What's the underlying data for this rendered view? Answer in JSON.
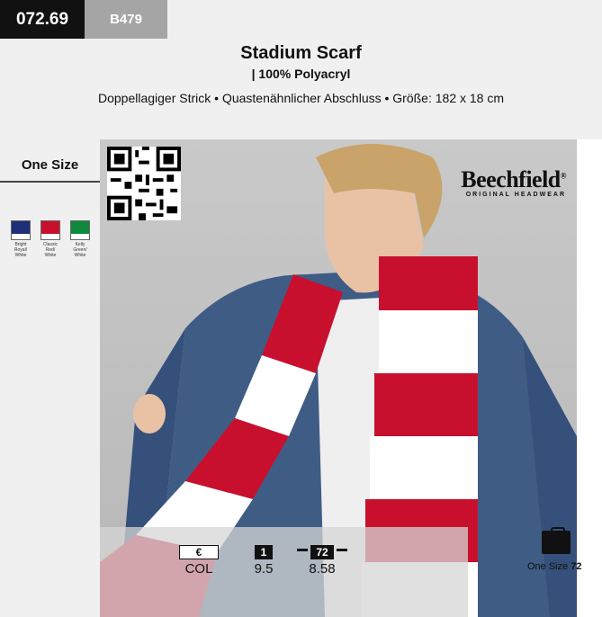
{
  "header": {
    "article_code": "072.69",
    "sku": "B479",
    "title": "Stadium Scarf",
    "material": "| 100% Polyacryl",
    "description": "Doppellagiger Strick • Quastenähnlicher Abschluss • Größe: 182 x 18 cm"
  },
  "sidebar": {
    "size_heading": "One Size",
    "swatches": [
      {
        "label": "Bright Royal/ White",
        "color": "#1f2f7a"
      },
      {
        "label": "Classic Red/ White",
        "color": "#c8102e"
      },
      {
        "label": "Kelly Green/ White",
        "color": "#0f8a3c"
      }
    ]
  },
  "brand": {
    "name": "Beechfield",
    "mark": "®",
    "tagline": "ORIGINAL HEADWEAR"
  },
  "pricing": {
    "currency_label": "€",
    "col_label": "COL",
    "qty1_label": "1",
    "qty1_price": "9.5",
    "qty72_label": "72",
    "qty72_price": "8.58"
  },
  "packaging": {
    "size_label": "One Size",
    "units": "72"
  },
  "icons": [
    "qr-code-icon",
    "box-icon"
  ],
  "colors": {
    "scarf_red": "#c8102e",
    "denim": "#3f5c85"
  }
}
